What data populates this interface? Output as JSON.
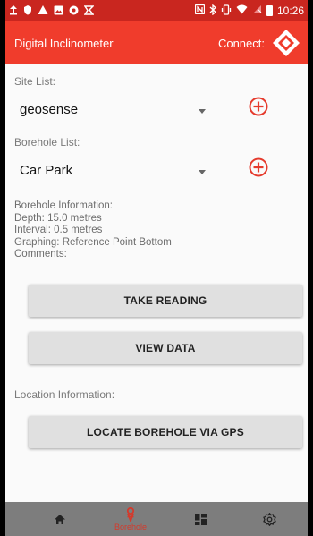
{
  "status_bar": {
    "left_icons": [
      "upload-icon",
      "shield-icon",
      "warning-icon",
      "image-icon",
      "record-icon",
      "send-icon"
    ],
    "right_icons": [
      "nfc-icon",
      "bluetooth-icon",
      "vibrate-icon",
      "wifi-icon",
      "no-sim-icon",
      "battery-icon"
    ],
    "time": "10:26"
  },
  "app_bar": {
    "title": "Digital Inclinometer",
    "connect_label": "Connect:",
    "connect_icon": "diamond-logo-icon"
  },
  "site": {
    "label": "Site List:",
    "selected": "geosense"
  },
  "borehole": {
    "label": "Borehole List:",
    "selected": "Car Park"
  },
  "borehole_info": {
    "heading": "Borehole Information:",
    "depth": "Depth: 15.0 metres",
    "interval": "Interval: 0.5 metres",
    "graphing": "Graphing: Reference Point Bottom",
    "comments": "Comments:"
  },
  "buttons": {
    "take_reading": "TAKE READING",
    "view_data": "VIEW DATA",
    "locate_gps": "LOCATE BOREHOLE VIA GPS"
  },
  "location": {
    "label": "Location Information:"
  },
  "bottom_nav": {
    "items": [
      {
        "icon": "home-icon",
        "label": ""
      },
      {
        "icon": "borehole-icon",
        "label": "Borehole"
      },
      {
        "icon": "dashboard-icon",
        "label": ""
      },
      {
        "icon": "settings-icon",
        "label": ""
      }
    ]
  },
  "colors": {
    "status_bar": "#c9261f",
    "app_bar": "#f03c2c",
    "accent": "#e53a2c",
    "button_bg": "#e0e0e0",
    "bottom_nav": "#7d7d7d"
  }
}
